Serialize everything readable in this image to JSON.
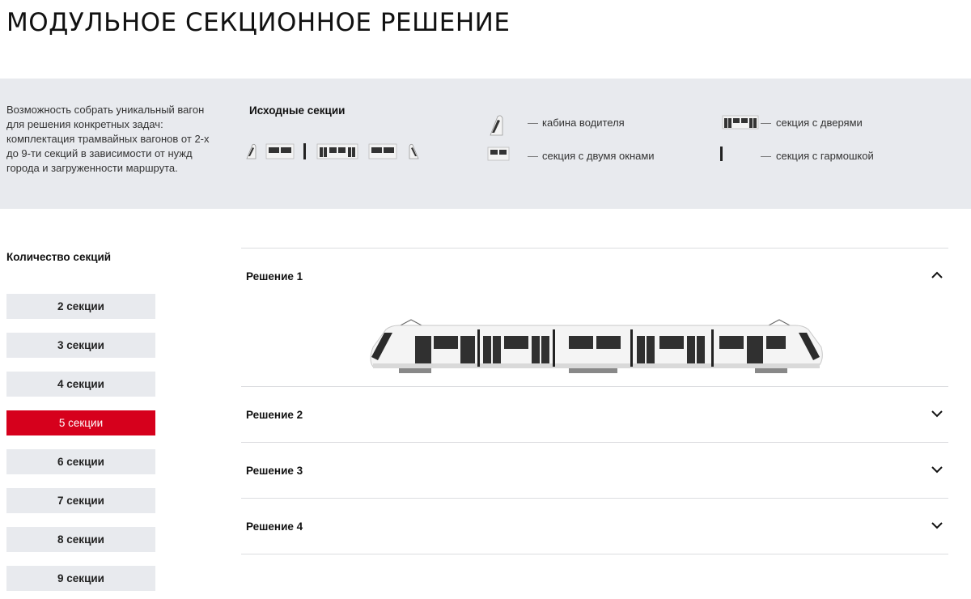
{
  "page": {
    "title": "МОДУЛЬНОЕ СЕКЦИОННОЕ РЕШЕНИЕ"
  },
  "info": {
    "description": "Возможность собрать уникальный вагон для решения конкретных задач: комплектация трамвайных вагонов от 2-х до 9-ти секций в зависимости от нужд города и загруженности маршрута.",
    "source_title": "Исходные секции",
    "legend": [
      {
        "icon": "cab-icon",
        "label": "кабина водителя"
      },
      {
        "icon": "two-window-section-icon",
        "label": "секция с двумя окнами"
      },
      {
        "icon": "door-section-icon",
        "label": "секция с дверями"
      },
      {
        "icon": "articulation-icon",
        "label": "секция с гармошкой"
      }
    ],
    "dash": "—"
  },
  "sections_count": {
    "title": "Количество секций",
    "options": [
      "2 секции",
      "3 секции",
      "4 секции",
      "5 секции",
      "6 секции",
      "7 секции",
      "8 секции",
      "9 секции"
    ],
    "selected": "5 секции"
  },
  "solutions": [
    {
      "label": "Решение 1",
      "expanded": true
    },
    {
      "label": "Решение 2",
      "expanded": false
    },
    {
      "label": "Решение 3",
      "expanded": false
    },
    {
      "label": "Решение 4",
      "expanded": false
    }
  ],
  "colors": {
    "accent": "#d6001c",
    "band_bg": "#e8eaee",
    "button_bg": "#e8eaee"
  }
}
